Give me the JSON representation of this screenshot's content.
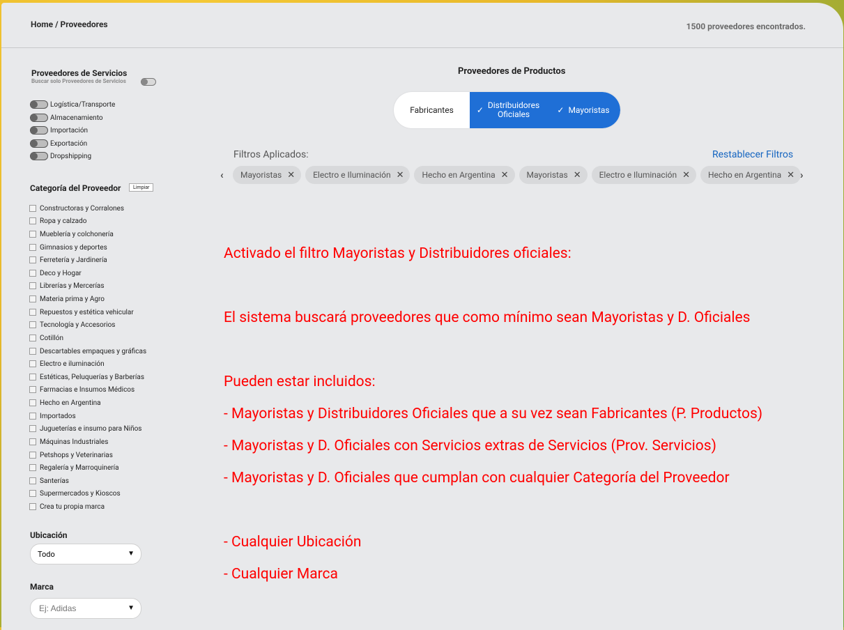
{
  "header": {
    "breadcrumb": "Home / Proveedores",
    "results_count": "1500 proveedores encontrados."
  },
  "services": {
    "title": "Proveedores de Servicios",
    "only_label": "Buscar solo Proveedores de Servicios",
    "items": [
      "Logística/Transporte",
      "Almacenamiento",
      "Importación",
      "Exportación",
      "Dropshipping"
    ]
  },
  "categories": {
    "title": "Categoría del Proveedor",
    "clear_label": "Limpiar",
    "items": [
      "Constructoras y Corralones",
      "Ropa y calzado",
      "Mueblería y colchonería",
      "Gimnasios y deportes",
      "Ferretería y Jardinería",
      "Deco y Hogar",
      "Librerías y Mercerías",
      "Materia prima y Agro",
      "Repuestos y estética vehicular",
      "Tecnología y Accesorios",
      "Cotillón",
      "Descartables empaques y gráficas",
      "Electro e iluminación",
      "Estéticas, Peluquerías y Barberías",
      "Farmacias e Insumos Médicos",
      "Hecho en Argentina",
      "Importados",
      "Jugueterías e insumo para Niños",
      "Máquinas Industriales",
      "Petshops y Veterinarias",
      "Regalería y Marroquinería",
      "Santerías",
      "Supermercados y Kioscos",
      "Crea tu propia marca"
    ]
  },
  "location": {
    "title": "Ubicación",
    "value": "Todo"
  },
  "brand": {
    "title": "Marca",
    "placeholder": "Ej: Adidas"
  },
  "products": {
    "title": "Proveedores de Productos",
    "segments": {
      "fabricantes": "Fabricantes",
      "distribuidores_1": "Distribuidores",
      "distribuidores_2": "Oficiales",
      "mayoristas": "Mayoristas"
    }
  },
  "filters": {
    "label": "Filtros Aplicados:",
    "reset_label": "Restablecer Filtros",
    "chips": [
      "Mayoristas",
      "Electro e Iluminación",
      "Hecho en Argentina",
      "Mayoristas",
      "Electro e Iluminación",
      "Hecho en Argentina"
    ]
  },
  "message": {
    "line1": "Activado el filtro Mayoristas y Distribuidores oficiales:",
    "line2": "El sistema buscará proveedores que como mínimo sean Mayoristas y D. Oficiales",
    "line3": "Pueden estar incluidos:",
    "line4": "- Mayoristas y Distribuidores Oficiales que a su vez sean Fabricantes (P. Productos)",
    "line5": "- Mayoristas y D. Oficiales con Servicios extras de Servicios (Prov. Servicios)",
    "line6": "- Mayoristas y D. Oficiales que cumplan con cualquier Categoría del Proveedor",
    "line7": "- Cualquier Ubicación",
    "line8": "- Cualquier Marca"
  },
  "colors": {
    "accent": "#1f6fd6",
    "message": "#ff0000",
    "panel": "#e8e9eb"
  }
}
